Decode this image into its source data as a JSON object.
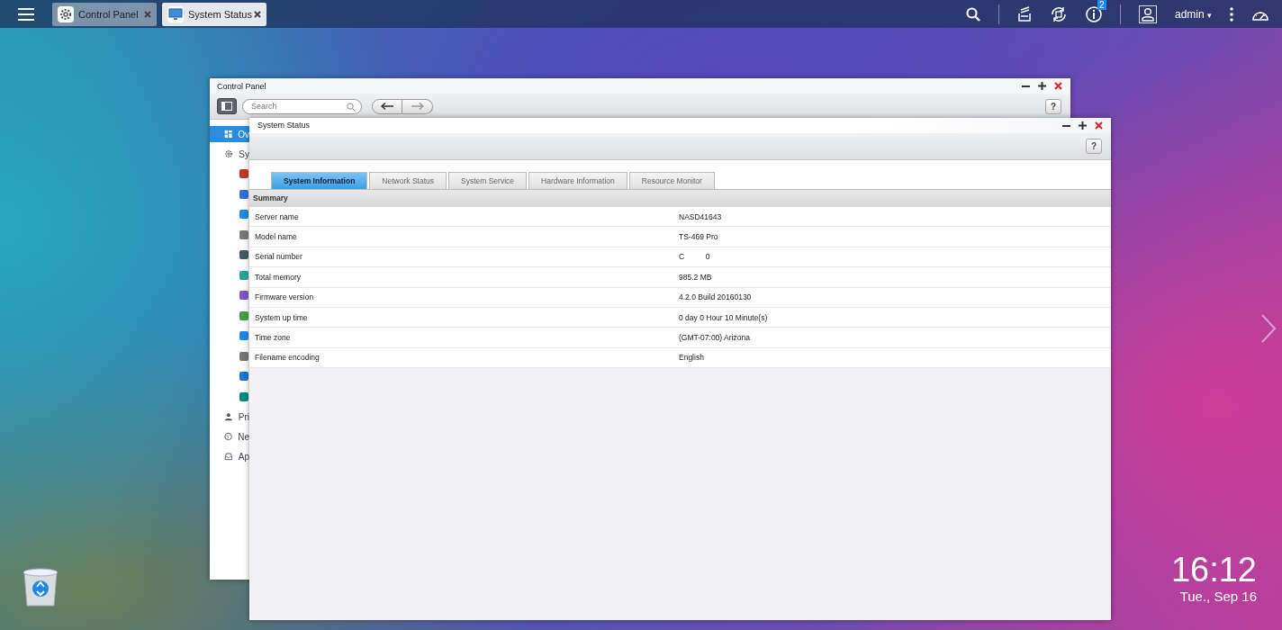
{
  "taskbar": {
    "apps": [
      {
        "label": "Control Panel",
        "selected": false
      },
      {
        "label": "System Status",
        "selected": true
      }
    ],
    "badge": "2",
    "user": "admin",
    "caret": "▾"
  },
  "control_panel": {
    "title": "Control Panel",
    "search": {
      "placeholder": "Search"
    },
    "help": "?",
    "sidebar": [
      {
        "label": "Ov",
        "selected": true
      },
      {
        "label": "Sy",
        "selected": false,
        "expanded": true
      },
      {
        "label": "Pri",
        "selected": false
      },
      {
        "label": "Ne",
        "selected": false
      },
      {
        "label": "Ap",
        "selected": false
      }
    ]
  },
  "system_status": {
    "title": "System Status",
    "help": "?",
    "tabs": [
      {
        "label": "System Information",
        "selected": true
      },
      {
        "label": "Network Status",
        "selected": false
      },
      {
        "label": "System Service",
        "selected": false
      },
      {
        "label": "Hardware Information",
        "selected": false
      },
      {
        "label": "Resource Monitor",
        "selected": false
      }
    ],
    "section": "Summary",
    "rows": [
      {
        "label": "Server name",
        "value": "NASD41643"
      },
      {
        "label": "Model name",
        "value": "TS-469 Pro"
      },
      {
        "label": "Serial number",
        "value": "C          0"
      },
      {
        "label": "Total memory",
        "value": "985.2 MB"
      },
      {
        "label": "Firmware version",
        "value": "4.2.0 Build 20160130"
      },
      {
        "label": "System up time",
        "value": "0 day 0 Hour 10 Minute(s)"
      },
      {
        "label": "Time zone",
        "value": "(GMT-07:00) Arizona"
      },
      {
        "label": "Filename encoding",
        "value": "English"
      }
    ]
  },
  "clock": {
    "time": "16:12",
    "date": "Tue., Sep 16"
  }
}
